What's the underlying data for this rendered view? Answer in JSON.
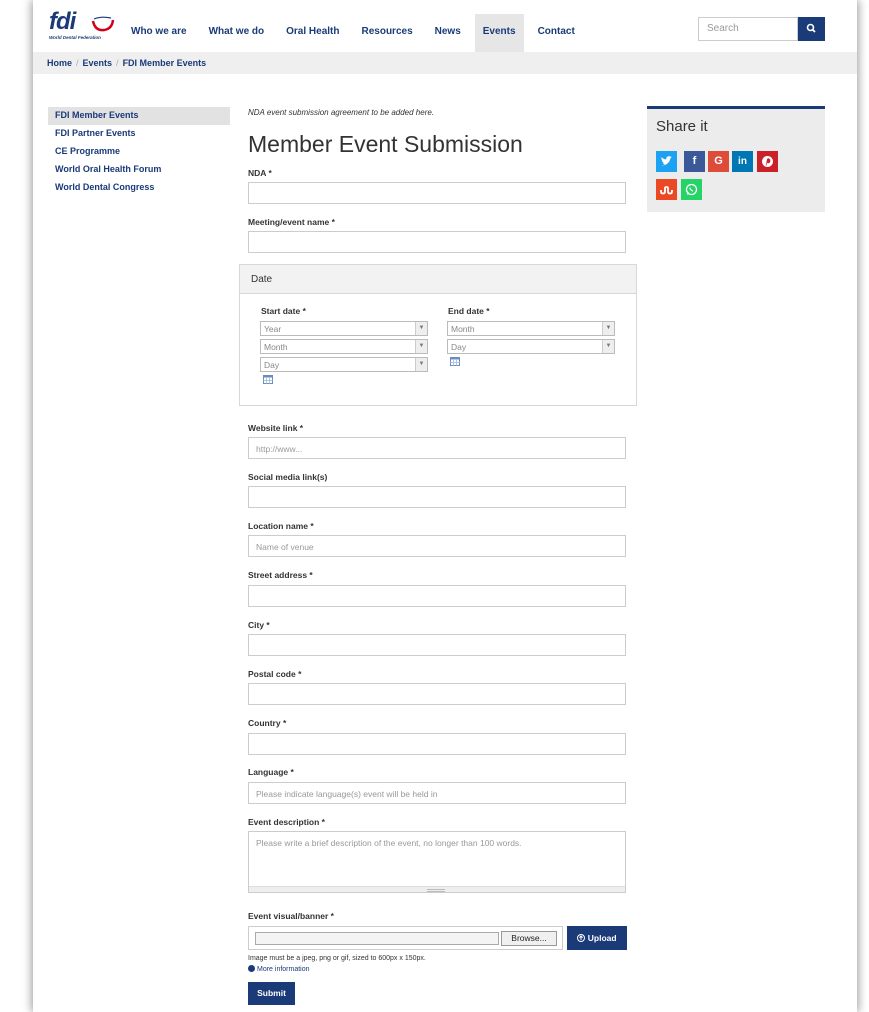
{
  "header": {
    "logo_text": "fdi",
    "logo_tagline": "World Dental Federation",
    "nav": [
      {
        "label": "Who we are"
      },
      {
        "label": "What we do"
      },
      {
        "label": "Oral Health"
      },
      {
        "label": "Resources"
      },
      {
        "label": "News"
      },
      {
        "label": "Events",
        "active": true
      },
      {
        "label": "Contact"
      }
    ],
    "search_placeholder": "Search"
  },
  "breadcrumb": [
    "Home",
    "Events",
    "FDI Member Events"
  ],
  "sidebar": {
    "items": [
      {
        "label": "FDI Member Events",
        "active": true
      },
      {
        "label": "FDI Partner Events"
      },
      {
        "label": "CE Programme"
      },
      {
        "label": "World Oral Health Forum"
      },
      {
        "label": "World Dental Congress"
      }
    ]
  },
  "form": {
    "note": "NDA event submission agreement to be added here.",
    "title": "Member Event Submission",
    "nda_label": "NDA *",
    "event_name_label": "Meeting/event name *",
    "date_section": "Date",
    "start_label": "Start date *",
    "end_label": "End date *",
    "year_ph": "Year",
    "month_ph": "Month",
    "day_ph": "Day",
    "website_label": "Website link *",
    "website_ph": "http://www...",
    "social_label": "Social media link(s)",
    "location_label": "Location name *",
    "location_ph": "Name of venue",
    "street_label": "Street address *",
    "city_label": "City *",
    "postal_label": "Postal code *",
    "country_label": "Country *",
    "language_label": "Language *",
    "language_ph": "Please indicate language(s) event will be held in",
    "description_label": "Event description *",
    "description_ph": "Please write a brief description of the event, no longer than 100 words.",
    "banner_label": "Event visual/banner *",
    "browse_label": "Browse...",
    "upload_label": "Upload",
    "help_text": "Image must be a jpeg, png or gif, sized to 600px x 150px.",
    "more_info": "More information",
    "submit_label": "Submit"
  },
  "share": {
    "title": "Share it",
    "buttons": [
      {
        "name": "twitter",
        "color": "#1da1f2"
      },
      {
        "name": "facebook",
        "color": "#3b5998"
      },
      {
        "name": "google",
        "color": "#dd4b39"
      },
      {
        "name": "linkedin",
        "color": "#0077b5"
      },
      {
        "name": "pinterest",
        "color": "#cb2027"
      },
      {
        "name": "stumbleupon",
        "color": "#eb4924"
      },
      {
        "name": "whatsapp",
        "color": "#25d366"
      }
    ]
  },
  "colors": {
    "brand": "#1a3a78",
    "accent_red": "#d0021b"
  }
}
